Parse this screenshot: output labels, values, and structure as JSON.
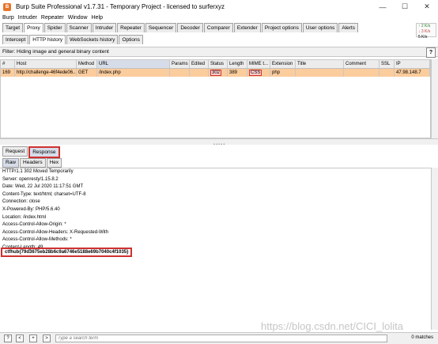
{
  "window": {
    "title": "Burp Suite Professional v1.7.31 - Temporary Project - licensed to surferxyz",
    "minimize": "—",
    "maximize": "☐",
    "close": "✕"
  },
  "menu": [
    "Burp",
    "Intruder",
    "Repeater",
    "Window",
    "Help"
  ],
  "main_tabs": [
    "Target",
    "Proxy",
    "Spider",
    "Scanner",
    "Intruder",
    "Repeater",
    "Sequencer",
    "Decoder",
    "Comparer",
    "Extender",
    "Project options",
    "User options",
    "Alerts"
  ],
  "active_main_tab": "Proxy",
  "sub_tabs": [
    "Intercept",
    "HTTP history",
    "WebSockets history",
    "Options"
  ],
  "active_sub_tab": "HTTP history",
  "net_widget": [
    "↑ 2 K/s",
    "↓ 3 K/s",
    "5 K/s"
  ],
  "filter": {
    "text": "Filter: Hiding image and general binary content",
    "help": "?"
  },
  "table": {
    "headers": [
      "#",
      "Host",
      "Method",
      "URL",
      "Params",
      "Edited",
      "Status",
      "Length",
      "MIME t...",
      "Extension",
      "Title",
      "Comment",
      "SSL",
      "IP"
    ],
    "row": {
      "num": "169",
      "host": "http://challenge-46f4ede06...",
      "method": "GET",
      "url": "/index.php",
      "params": "",
      "edited": "",
      "status": "302",
      "length": "389",
      "mime": "CSS",
      "extension": "php",
      "title": "",
      "comment": "",
      "ssl": "",
      "ip": "47.98.148.7"
    }
  },
  "req_tabs": [
    "Request",
    "Response"
  ],
  "active_req_tab": "Response",
  "view_tabs": [
    "Raw",
    "Headers",
    "Hex"
  ],
  "active_view_tab": "Raw",
  "response_lines": [
    "HTTP/1.1 302 Moved Temporarily",
    "Server: openresty/1.15.8.2",
    "Date: Wed, 22 Jul 2020 11:17:51 GMT",
    "Content-Type: text/html; charset=UTF-8",
    "Connection: close",
    "X-Powered-By: PHP/5.6.40",
    "Location: /index.html",
    "Access-Control-Allow-Origin: *",
    "Access-Control-Allow-Headers: X-Requested-With",
    "Access-Control-Allow-Methods: *",
    "Content-Length: 49"
  ],
  "flag": "ctfhub{79d3675eb28b6c9a6746e5188e69b7040c4f1035}",
  "search": {
    "placeholder": "Type a search term",
    "matches": "0 matches",
    "buttons": [
      "?",
      "<",
      "+",
      ">"
    ]
  },
  "watermark": "https://blog.csdn.net/CICI_lolita"
}
